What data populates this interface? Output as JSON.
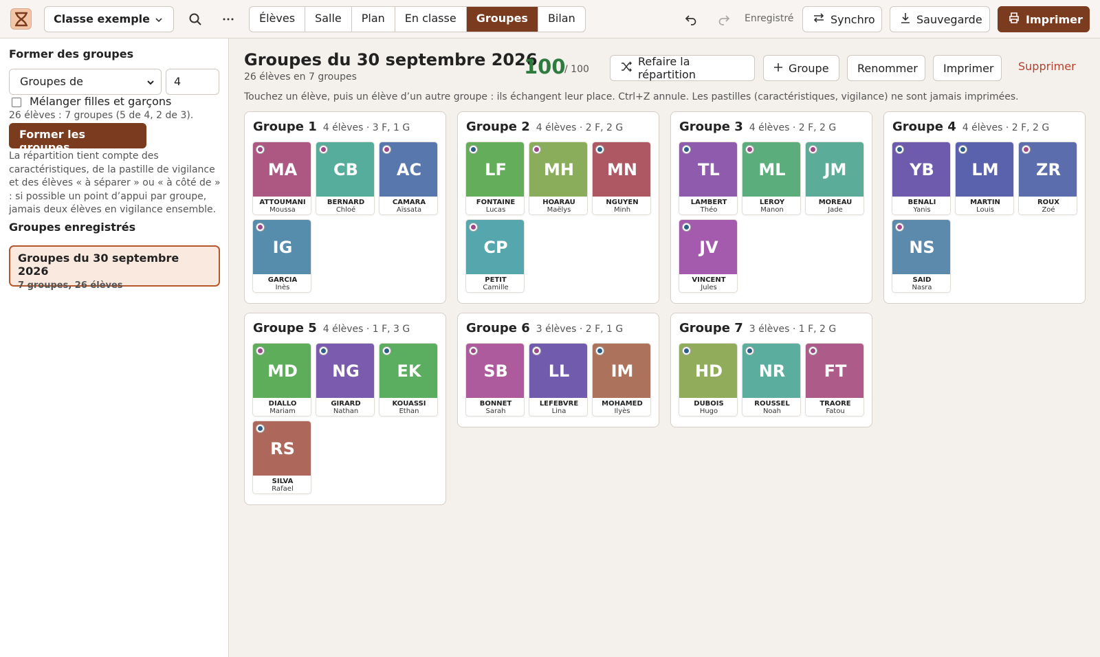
{
  "app": {
    "logo": "hourglass-icon",
    "class_name": "Classe exemple",
    "tabs": [
      "Élèves",
      "Salle",
      "Plan",
      "En classe",
      "Groupes",
      "Bilan"
    ],
    "active_tab": "Groupes",
    "saved_status": "Enregistré",
    "sync_label": "Synchro",
    "backup_label": "Sauvegarde",
    "print_label": "Imprimer",
    "accent": "#7a3b1e"
  },
  "sidebar": {
    "heading": "Former des groupes",
    "mode_value": "Groupes de",
    "size_value": "4",
    "mix_label": "Mélanger filles et garçons",
    "mix_checked": false,
    "info": "26 élèves : 7 groupes (5 de 4, 2 de 3).",
    "form_button": "Former les groupes",
    "description": "La répartition tient compte des caractéristiques, de la pastille de vigilance et des élèves « à séparer » ou « à côté de » : si possible un point d’appui par groupe, jamais deux élèves en vigilance ensemble.",
    "saved_heading": "Groupes enregistrés",
    "saved_title": "Groupes du 30 septembre 2026",
    "saved_sub": "7 groupes, 26 élèves"
  },
  "main": {
    "title": "Groupes du 30 septembre 2026",
    "subtitle": "26 élèves en 7 groupes",
    "score": "100",
    "score_of": "/ 100",
    "reshuffle_label": "Refaire la répartition",
    "add_group_label": "Groupe",
    "rename_label": "Renommer",
    "print_label": "Imprimer",
    "delete_label": "Supprimer",
    "hint": "Touchez un élève, puis un élève d’un autre groupe : ils échangent leur place. Ctrl+Z annule. Les pastilles (caractéristiques, vigilance) ne sont jamais imprimées."
  },
  "colors": {
    "girl_dot": "#a0488a",
    "boy_dot": "#2e5f8a"
  },
  "groups": [
    {
      "name": "Groupe 1",
      "meta": "4 élèves · 3 F, 1 G",
      "students": [
        {
          "initials": "MA",
          "last": "ATTOUMANI",
          "first": "Moussa",
          "color": "#ad5883",
          "dot": "girl"
        },
        {
          "initials": "CB",
          "last": "BERNARD",
          "first": "Chloé",
          "color": "#56ad9c",
          "dot": "girl"
        },
        {
          "initials": "AC",
          "last": "CAMARA",
          "first": "Aïssata",
          "color": "#5877ad",
          "dot": "girl"
        },
        {
          "initials": "IG",
          "last": "GARCIA",
          "first": "Inès",
          "color": "#568dad",
          "dot": "girl"
        }
      ]
    },
    {
      "name": "Groupe 2",
      "meta": "4 élèves · 2 F, 2 G",
      "students": [
        {
          "initials": "LF",
          "last": "FONTAINE",
          "first": "Lucas",
          "color": "#64ad5b",
          "dot": "boy"
        },
        {
          "initials": "MH",
          "last": "HOARAU",
          "first": "Maëlys",
          "color": "#8aad5b",
          "dot": "girl"
        },
        {
          "initials": "MN",
          "last": "NGUYEN",
          "first": "Minh",
          "color": "#ad5862",
          "dot": "boy"
        },
        {
          "initials": "CP",
          "last": "PETIT",
          "first": "Camille",
          "color": "#56a6ad",
          "dot": "girl"
        }
      ]
    },
    {
      "name": "Groupe 3",
      "meta": "4 élèves · 2 F, 2 G",
      "students": [
        {
          "initials": "TL",
          "last": "LAMBERT",
          "first": "Théo",
          "color": "#8e5bad",
          "dot": "boy"
        },
        {
          "initials": "ML",
          "last": "LEROY",
          "first": "Manon",
          "color": "#5bad7c",
          "dot": "girl"
        },
        {
          "initials": "JM",
          "last": "MOREAU",
          "first": "Jade",
          "color": "#5bad9a",
          "dot": "girl"
        },
        {
          "initials": "JV",
          "last": "VINCENT",
          "first": "Jules",
          "color": "#a55bad",
          "dot": "boy"
        }
      ]
    },
    {
      "name": "Groupe 4",
      "meta": "4 élèves · 2 F, 2 G",
      "students": [
        {
          "initials": "YB",
          "last": "BENALI",
          "first": "Yanis",
          "color": "#6e5bad",
          "dot": "boy"
        },
        {
          "initials": "LM",
          "last": "MARTIN",
          "first": "Louis",
          "color": "#5b62ad",
          "dot": "boy"
        },
        {
          "initials": "ZR",
          "last": "ROUX",
          "first": "Zoé",
          "color": "#5b6dad",
          "dot": "girl"
        },
        {
          "initials": "NS",
          "last": "SAID",
          "first": "Nasra",
          "color": "#5b8aad",
          "dot": "girl"
        }
      ]
    },
    {
      "name": "Groupe 5",
      "meta": "4 élèves · 1 F, 3 G",
      "students": [
        {
          "initials": "MD",
          "last": "DIALLO",
          "first": "Mariam",
          "color": "#5dad5b",
          "dot": "girl"
        },
        {
          "initials": "NG",
          "last": "GIRARD",
          "first": "Nathan",
          "color": "#7a5bad",
          "dot": "boy"
        },
        {
          "initials": "EK",
          "last": "KOUASSI",
          "first": "Ethan",
          "color": "#5bad5f",
          "dot": "boy"
        },
        {
          "initials": "RS",
          "last": "SILVA",
          "first": "Rafael",
          "color": "#ad685b",
          "dot": "boy"
        }
      ]
    },
    {
      "name": "Groupe 6",
      "meta": "3 élèves · 2 F, 1 G",
      "students": [
        {
          "initials": "SB",
          "last": "BONNET",
          "first": "Sarah",
          "color": "#ad5b9c",
          "dot": "girl"
        },
        {
          "initials": "LL",
          "last": "LEFEBVRE",
          "first": "Lina",
          "color": "#705bad",
          "dot": "girl"
        },
        {
          "initials": "IM",
          "last": "MOHAMED",
          "first": "Ilyès",
          "color": "#ad725b",
          "dot": "boy"
        }
      ]
    },
    {
      "name": "Groupe 7",
      "meta": "3 élèves · 1 F, 2 G",
      "students": [
        {
          "initials": "HD",
          "last": "DUBOIS",
          "first": "Hugo",
          "color": "#91ad5b",
          "dot": "boy"
        },
        {
          "initials": "NR",
          "last": "ROUSSEL",
          "first": "Noah",
          "color": "#5bad9e",
          "dot": "boy"
        },
        {
          "initials": "FT",
          "last": "TRAORE",
          "first": "Fatou",
          "color": "#ad5b88",
          "dot": "girl"
        }
      ]
    }
  ]
}
